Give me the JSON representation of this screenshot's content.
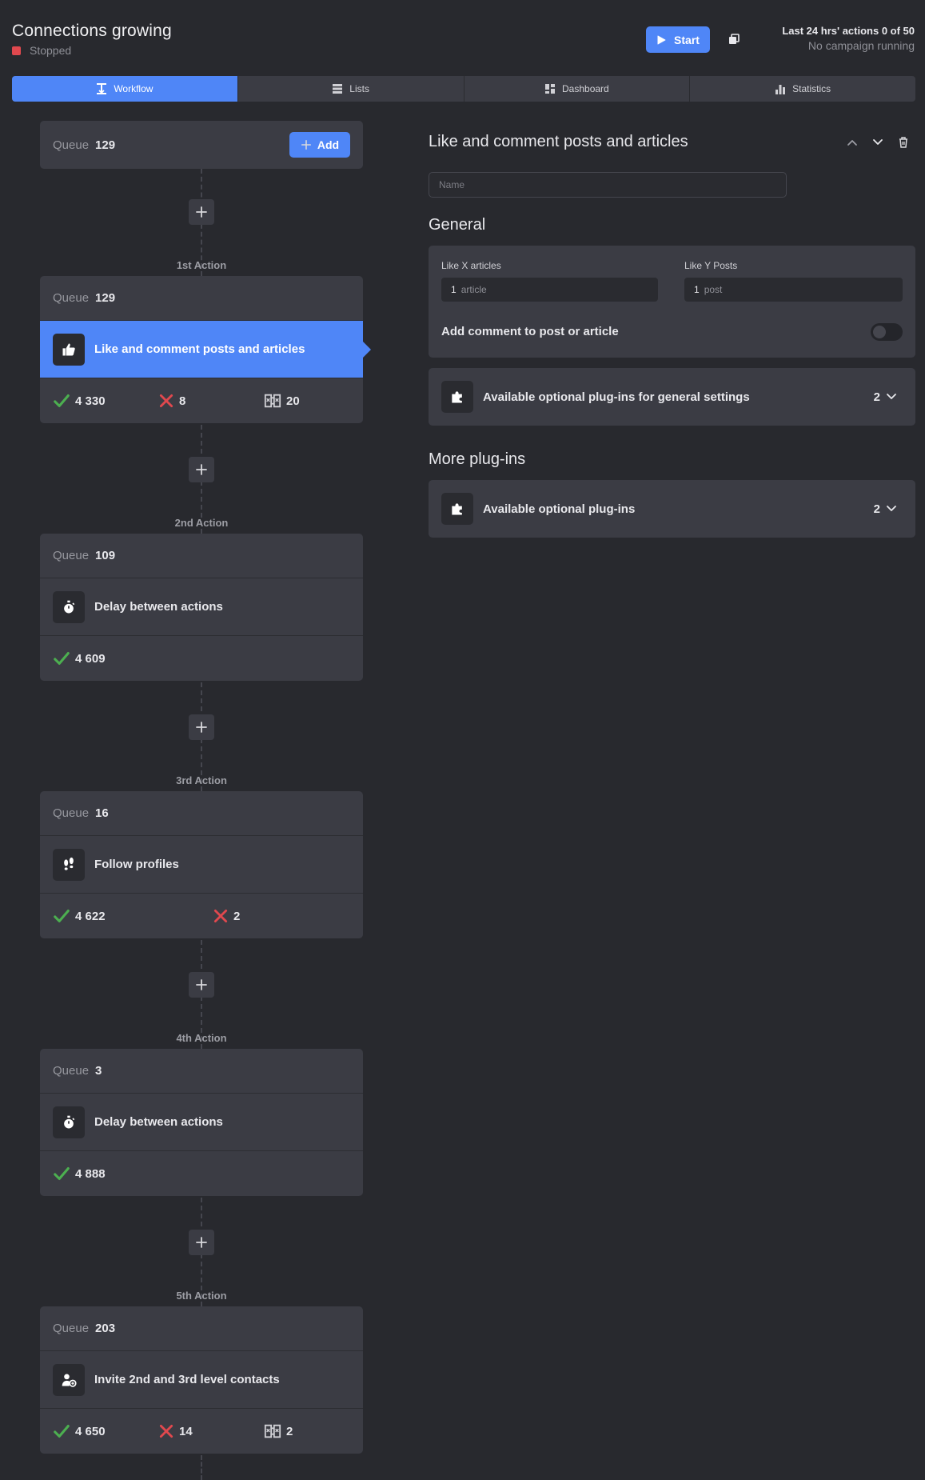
{
  "header": {
    "title": "Connections growing",
    "status": "Stopped",
    "status_color": "#e0484e",
    "start_label": "Start",
    "actions_summary": "Last 24 hrs' actions 0 of 50",
    "campaign_status": "No campaign running"
  },
  "tabs": [
    {
      "label": "Workflow",
      "icon": "workflow-icon",
      "active": true
    },
    {
      "label": "Lists",
      "icon": "list-icon",
      "active": false
    },
    {
      "label": "Dashboard",
      "icon": "dashboard-icon",
      "active": false
    },
    {
      "label": "Statistics",
      "icon": "statistics-icon",
      "active": false
    }
  ],
  "workflow": {
    "start_queue": {
      "label": "Queue",
      "value": "129",
      "add_label": "Add"
    },
    "actions": [
      {
        "step": "1st Action",
        "queue_label": "Queue",
        "queue": "129",
        "title": "Like and comment posts and articles",
        "icon": "thumbs-up-icon",
        "selected": true,
        "success": "4 330",
        "failed": "8",
        "skipped": "20"
      },
      {
        "step": "2nd Action",
        "queue_label": "Queue",
        "queue": "109",
        "title": "Delay between actions",
        "icon": "stopwatch-icon",
        "selected": false,
        "success": "4 609"
      },
      {
        "step": "3rd Action",
        "queue_label": "Queue",
        "queue": "16",
        "title": "Follow profiles",
        "icon": "footprints-icon",
        "selected": false,
        "success": "4 622",
        "failed": "2"
      },
      {
        "step": "4th Action",
        "queue_label": "Queue",
        "queue": "3",
        "title": "Delay between actions",
        "icon": "stopwatch-icon",
        "selected": false,
        "success": "4 888"
      },
      {
        "step": "5th Action",
        "queue_label": "Queue",
        "queue": "203",
        "title": "Invite 2nd and 3rd level contacts",
        "icon": "invite-user-icon",
        "selected": false,
        "success": "4 650",
        "failed": "14",
        "skipped": "2"
      }
    ]
  },
  "detail": {
    "title": "Like and comment posts and articles",
    "name_placeholder": "Name",
    "general_heading": "General",
    "like_articles_label": "Like X articles",
    "like_articles_value": "1",
    "like_articles_unit": "article",
    "like_posts_label": "Like Y Posts",
    "like_posts_value": "1",
    "like_posts_unit": "post",
    "add_comment_label": "Add comment to post or article",
    "add_comment_enabled": false,
    "general_plugins_label": "Available optional plug-ins for general settings",
    "general_plugins_count": "2",
    "more_plugins_heading": "More plug-ins",
    "more_plugins_label": "Available optional plug-ins",
    "more_plugins_count": "2"
  },
  "colors": {
    "accent": "#4f86f7",
    "success": "#4caf50",
    "error": "#e0484e",
    "background": "#28292e",
    "card": "#3b3c44"
  }
}
